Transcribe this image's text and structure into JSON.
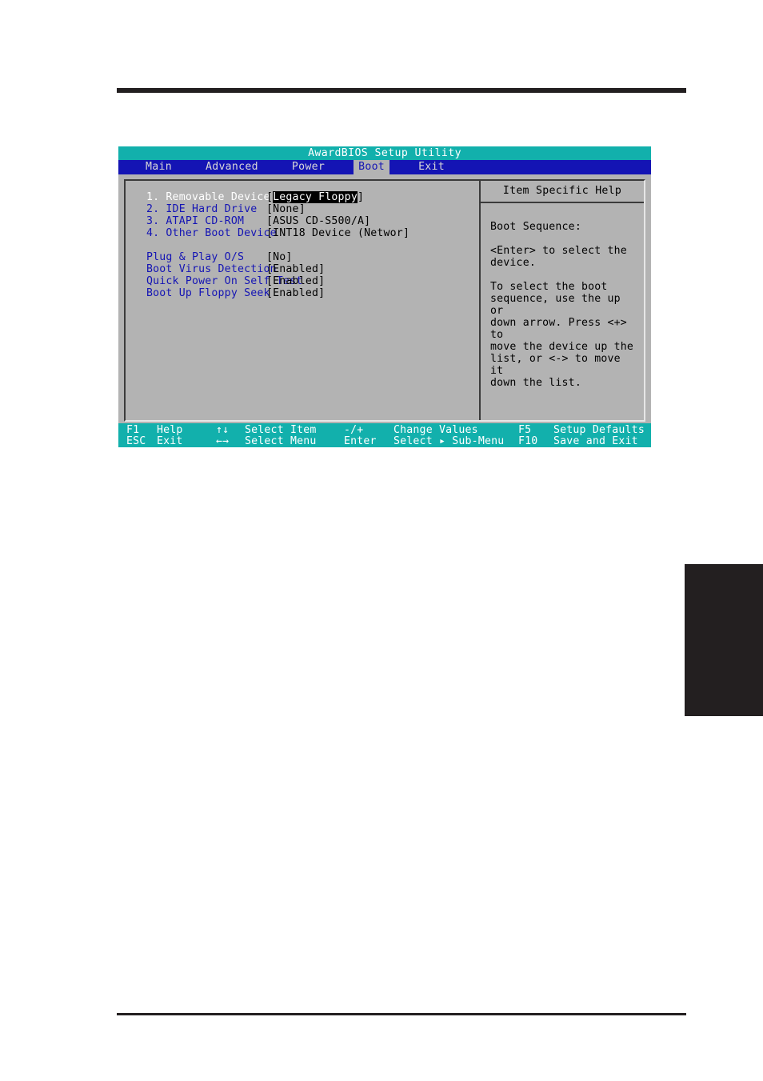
{
  "bios": {
    "title": "AwardBIOS Setup Utility",
    "menu_tabs": [
      {
        "label": "Main",
        "active": false
      },
      {
        "label": "Advanced",
        "active": false
      },
      {
        "label": "Power",
        "active": false
      },
      {
        "label": "Boot",
        "active": true
      },
      {
        "label": "Exit",
        "active": false
      }
    ],
    "boot_sequence": [
      {
        "label": "1. Removable Device",
        "value_prefix": "[",
        "value": "Legacy Floppy",
        "value_suffix": "]",
        "highlighted": true,
        "selected": true
      },
      {
        "label": "2. IDE Hard Drive",
        "value_prefix": "[",
        "value": "None",
        "value_suffix": "]",
        "highlighted": false,
        "selected": false
      },
      {
        "label": "3. ATAPI CD-ROM",
        "value_prefix": "[",
        "value": "ASUS CD-S500/A",
        "value_suffix": "]",
        "highlighted": false,
        "selected": false
      },
      {
        "label": "4. Other Boot Device",
        "value_prefix": "[",
        "value": "INT18 Device (Networ",
        "value_suffix": "]",
        "highlighted": false,
        "selected": false
      }
    ],
    "options": [
      {
        "label": "Plug & Play O/S",
        "value_prefix": "[",
        "value": "No",
        "value_suffix": "]"
      },
      {
        "label": "Boot Virus Detection",
        "value_prefix": "[",
        "value": "Enabled",
        "value_suffix": "]"
      },
      {
        "label": "Quick Power On Self Test",
        "value_prefix": "[",
        "value": "Enabled",
        "value_suffix": "]"
      },
      {
        "label": "Boot Up Floppy Seek",
        "value_prefix": "[",
        "value": "Enabled",
        "value_suffix": "]"
      }
    ],
    "help": {
      "title": "Item Specific Help",
      "paragraphs": [
        "Boot Sequence:",
        "<Enter> to select the\ndevice.",
        "To select the boot\nsequence, use the up or\ndown arrow. Press <+> to\nmove the device up the\nlist, or <-> to move it\ndown the list."
      ]
    },
    "statusbar": {
      "row1": [
        {
          "key": "F1",
          "action": "Help"
        },
        {
          "key": "↑↓",
          "action": "Select Item"
        },
        {
          "key": "-/+",
          "action": "Change Values"
        },
        {
          "key": "F5",
          "action": "Setup Defaults"
        }
      ],
      "row2": [
        {
          "key": "ESC",
          "action": "Exit"
        },
        {
          "key": "←→",
          "action": "Select Menu"
        },
        {
          "key": "Enter",
          "action": "Select ▸ Sub-Menu"
        },
        {
          "key": "F10",
          "action": "Save and Exit"
        }
      ]
    },
    "colors": {
      "titlebar": "#12b0ac",
      "menubar": "#1414b4",
      "panel_bg": "#b3b3b3",
      "label_blue": "#1414b4",
      "selected_white": "#ffffff"
    }
  }
}
